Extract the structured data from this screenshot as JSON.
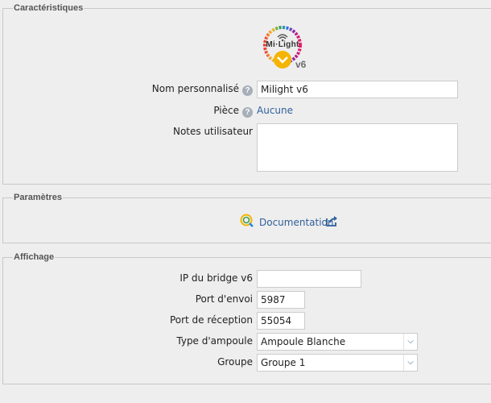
{
  "sections": {
    "characteristics": {
      "legend": "Caractéristiques",
      "logo": {
        "brand_text": "Mi·Light",
        "version_text": "v6",
        "icon": "milight-logo"
      },
      "custom_name": {
        "label": "Nom personnalisé",
        "value": "Milight v6",
        "help_icon": "question-circle-icon"
      },
      "room": {
        "label": "Pièce",
        "value": "Aucune",
        "help_icon": "question-circle-icon"
      },
      "notes": {
        "label": "Notes utilisateur",
        "value": ""
      }
    },
    "parameters": {
      "legend": "Paramètres",
      "documentation": {
        "label": "Documentation",
        "icon": "documentation-icon",
        "external_icon": "external-link-icon"
      }
    },
    "display": {
      "legend": "Affichage",
      "bridge_ip": {
        "label": "IP du bridge v6",
        "value": ""
      },
      "send_port": {
        "label": "Port d'envoi",
        "value": "5987"
      },
      "receive_port": {
        "label": "Port de réception",
        "value": "55054"
      },
      "bulb_type": {
        "label": "Type d'ampoule",
        "value": "Ampoule Blanche"
      },
      "group": {
        "label": "Groupe",
        "value": "Groupe 1"
      }
    }
  },
  "colors": {
    "link": "#2f5f9a",
    "background": "#eeeeee",
    "border": "#c8c8c8"
  }
}
